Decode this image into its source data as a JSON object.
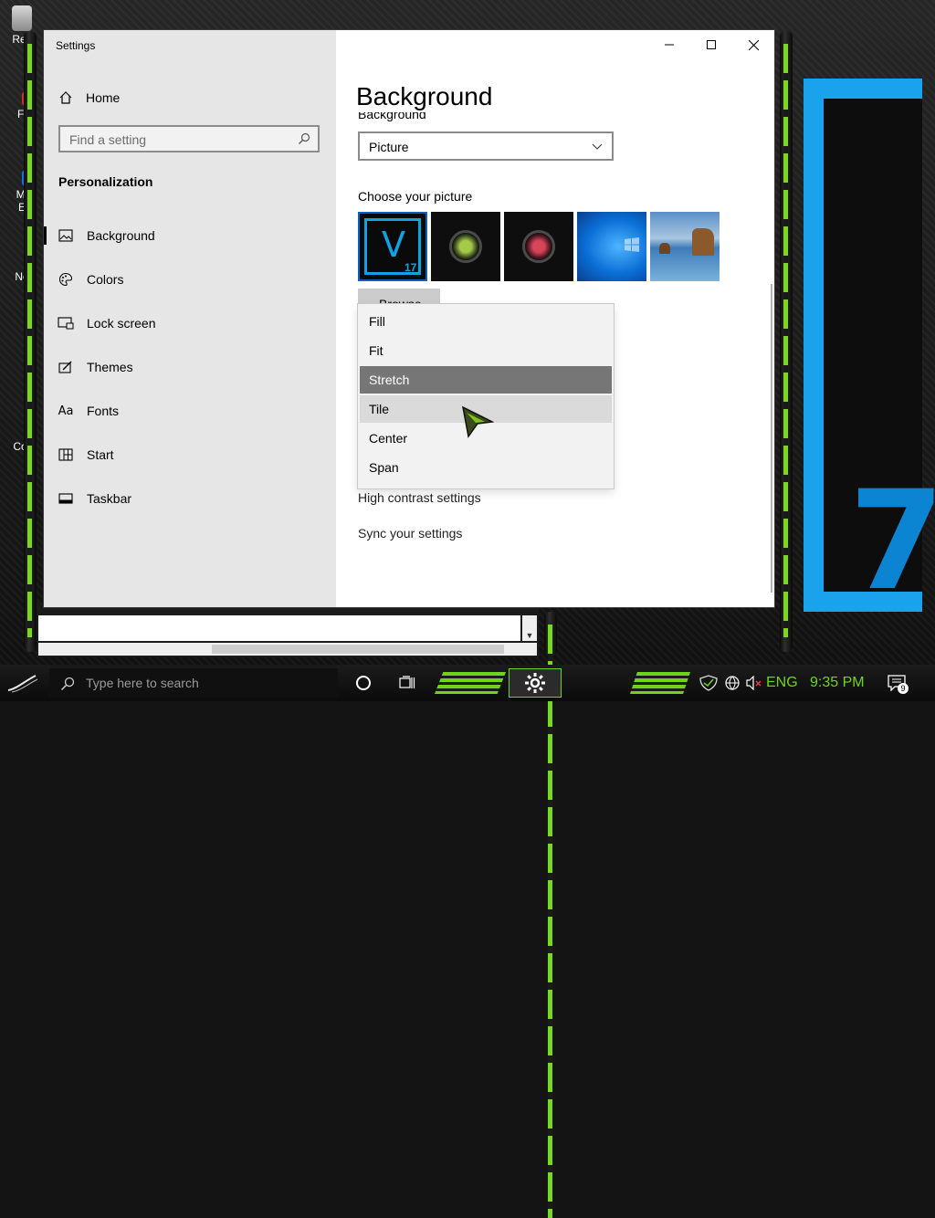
{
  "desktop": {
    "icons": [
      {
        "label": "Rec",
        "name": "recycle-bin-icon"
      },
      {
        "label": "Fi",
        "name": "file-icon"
      },
      {
        "label": "Mi\nE",
        "name": "edge-icon"
      },
      {
        "label": "Ne",
        "name": "network-icon"
      },
      {
        "label": "Cor",
        "name": "control-panel-icon"
      }
    ]
  },
  "window": {
    "title": "Settings",
    "controls": [
      "minimize",
      "maximize",
      "close"
    ]
  },
  "sidebar": {
    "home_label": "Home",
    "search_placeholder": "Find a setting",
    "section_title": "Personalization",
    "items": [
      {
        "label": "Background",
        "icon": "picture-icon",
        "active": true
      },
      {
        "label": "Colors",
        "icon": "palette-icon"
      },
      {
        "label": "Lock screen",
        "icon": "lock-screen-icon"
      },
      {
        "label": "Themes",
        "icon": "themes-icon"
      },
      {
        "label": "Fonts",
        "icon": "fonts-icon"
      },
      {
        "label": "Start",
        "icon": "start-icon"
      },
      {
        "label": "Taskbar",
        "icon": "taskbar-icon"
      }
    ]
  },
  "main": {
    "title": "Background",
    "background_label": "Background",
    "background_value": "Picture",
    "choose_picture_label": "Choose your picture",
    "thumbnails": [
      "vegas-17-thumb",
      "green-orb-thumb",
      "red-orb-thumb",
      "windows-blue-thumb",
      "beach-thumb"
    ],
    "thumbnail_text": {
      "v": "V",
      "num": "17"
    },
    "browse_label": "Browse",
    "fit_options": [
      "Fill",
      "Fit",
      "Stretch",
      "Tile",
      "Center",
      "Span"
    ],
    "fit_selected": "Stretch",
    "fit_hovered": "Tile",
    "links": [
      "High contrast settings",
      "Sync your settings"
    ]
  },
  "taskbar": {
    "search_placeholder": "Type here to search",
    "language": "ENG",
    "time": "9:35 PM",
    "notification_count": "9",
    "accent": "#6fd41a"
  },
  "colors": {
    "accent_blue": "#1aa3ec",
    "selected_option": "#767676",
    "hover_option": "#dadada"
  }
}
